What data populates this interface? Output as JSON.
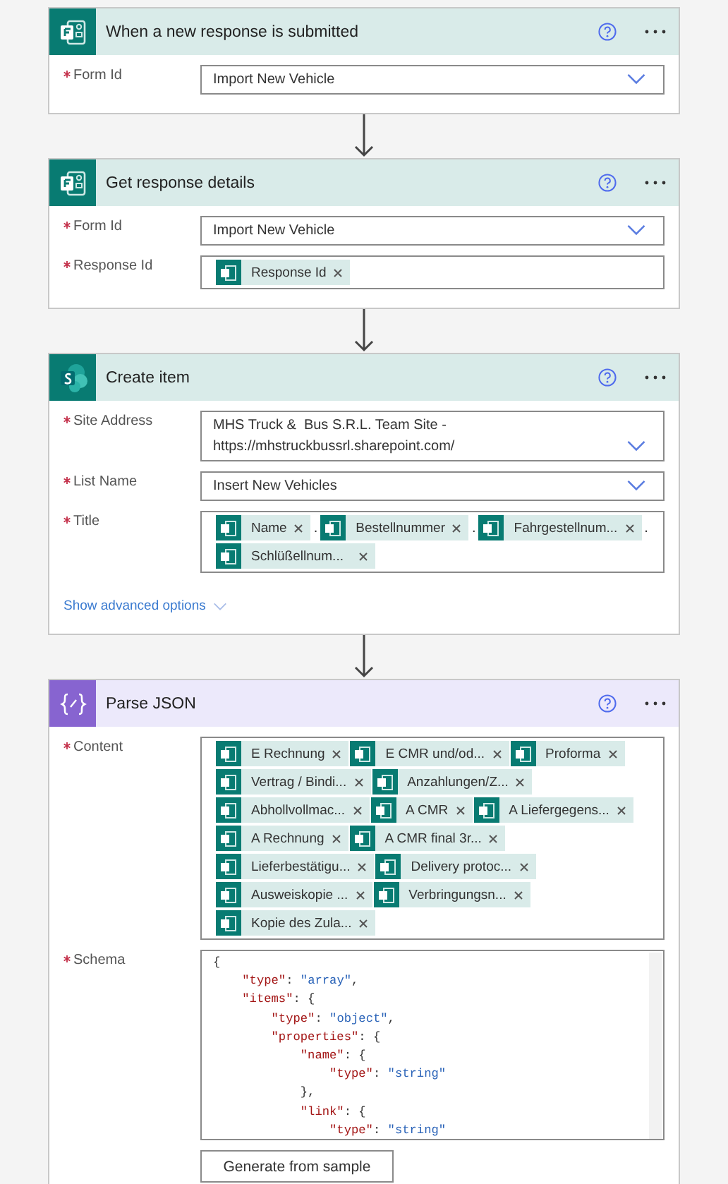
{
  "cards": [
    {
      "kind": "forms",
      "title": "When a new response is submitted",
      "fields": [
        {
          "label": "Form Id",
          "required": true,
          "kind": "dropdown",
          "value": "Import New Vehicle"
        }
      ]
    },
    {
      "kind": "forms",
      "title": "Get response details",
      "fields": [
        {
          "label": "Form Id",
          "required": true,
          "kind": "dropdown",
          "value": "Import New Vehicle"
        },
        {
          "label": "Response Id",
          "required": true,
          "kind": "tokens",
          "rows": [
            [
              {
                "kind": "token",
                "text": "Response Id"
              }
            ]
          ]
        }
      ]
    },
    {
      "kind": "sharepoint",
      "title": "Create item",
      "fields": [
        {
          "label": "Site Address",
          "required": true,
          "kind": "dropdown",
          "value": "MHS Truck &  Bus S.R.L. Team Site - https://mhstruckbussrl.sharepoint.com/"
        },
        {
          "label": "List Name",
          "required": true,
          "kind": "dropdown",
          "value": "Insert New Vehicles"
        },
        {
          "label": "Title",
          "required": true,
          "kind": "tokens",
          "rows": [
            [
              {
                "kind": "token",
                "text": "Name"
              },
              {
                "kind": "text",
                "text": "."
              },
              {
                "kind": "token",
                "text": "Bestellnummer"
              },
              {
                "kind": "text",
                "text": "."
              },
              {
                "kind": "token",
                "text": "Fahrgestellnum..."
              },
              {
                "kind": "text",
                "text": "."
              }
            ],
            [
              {
                "kind": "token",
                "text": "Schlüßellnum...  "
              }
            ]
          ]
        }
      ],
      "advanced": "Show advanced options"
    },
    {
      "kind": "json",
      "title": "Parse JSON",
      "fields": [
        {
          "label": "Content",
          "required": true,
          "kind": "tokens",
          "rows": [
            [
              {
                "kind": "token",
                "text": "E Rechnung"
              },
              {
                "kind": "token",
                "text": "E CMR und/od..."
              },
              {
                "kind": "token",
                "text": "Proforma"
              }
            ],
            [
              {
                "kind": "token",
                "text": "Vertrag / Bindi..."
              },
              {
                "kind": "token",
                "text": "Anzahlungen/Z..."
              }
            ],
            [
              {
                "kind": "token",
                "text": "Abhollvollmac..."
              },
              {
                "kind": "token",
                "text": "A CMR"
              },
              {
                "kind": "token",
                "text": "A Liefergegens..."
              }
            ],
            [
              {
                "kind": "token",
                "text": "A Rechnung"
              },
              {
                "kind": "token",
                "text": "A CMR final 3r..."
              }
            ],
            [
              {
                "kind": "token",
                "text": "Lieferbestätigu..."
              },
              {
                "kind": "token",
                "text": "Delivery protoc..."
              }
            ],
            [
              {
                "kind": "token",
                "text": "Ausweiskopie ..."
              },
              {
                "kind": "token",
                "text": "Verbringungsn..."
              }
            ],
            [
              {
                "kind": "token",
                "text": "Kopie des Zula..."
              }
            ]
          ]
        },
        {
          "label": "Schema",
          "required": true,
          "kind": "code",
          "lines": [
            [
              {
                "kind": "punct",
                "text": "{"
              }
            ],
            [
              {
                "kind": "key",
                "text": "    \"type\""
              },
              {
                "kind": "punct",
                "text": ": "
              },
              {
                "kind": "string",
                "text": "\"array\""
              },
              {
                "kind": "punct",
                "text": ","
              }
            ],
            [
              {
                "kind": "key",
                "text": "    \"items\""
              },
              {
                "kind": "punct",
                "text": ": {"
              }
            ],
            [
              {
                "kind": "key",
                "text": "        \"type\""
              },
              {
                "kind": "punct",
                "text": ": "
              },
              {
                "kind": "string",
                "text": "\"object\""
              },
              {
                "kind": "punct",
                "text": ","
              }
            ],
            [
              {
                "kind": "key",
                "text": "        \"properties\""
              },
              {
                "kind": "punct",
                "text": ": {"
              }
            ],
            [
              {
                "kind": "key",
                "text": "            \"name\""
              },
              {
                "kind": "punct",
                "text": ": {"
              }
            ],
            [
              {
                "kind": "key",
                "text": "                \"type\""
              },
              {
                "kind": "punct",
                "text": ": "
              },
              {
                "kind": "string",
                "text": "\"string\""
              }
            ],
            [
              {
                "kind": "punct",
                "text": "            },"
              }
            ],
            [
              {
                "kind": "key",
                "text": "            \"link\""
              },
              {
                "kind": "punct",
                "text": ": {"
              }
            ],
            [
              {
                "kind": "key",
                "text": "                \"type\""
              },
              {
                "kind": "punct",
                "text": ": "
              },
              {
                "kind": "string",
                "text": "\"string\""
              }
            ]
          ]
        }
      ],
      "button": "Generate from sample"
    }
  ]
}
